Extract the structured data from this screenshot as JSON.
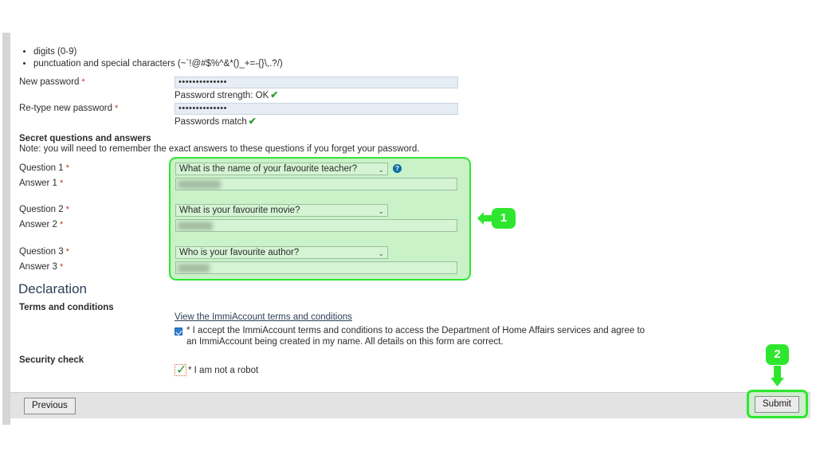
{
  "password_rules": [
    "digits (0-9)",
    "punctuation and special characters (~`!@#$%^&*()_+=-{}\\,.?/)"
  ],
  "password_section": {
    "new_password_label": "New password",
    "new_password_value": "••••••••••••••",
    "new_password_hint": "Password strength: OK",
    "retype_label": "Re-type new password",
    "retype_value": "••••••••••••••",
    "retype_hint": "Passwords match",
    "required_marker": "*",
    "tick_glyph": "✔"
  },
  "secret_section": {
    "heading": "Secret questions and answers",
    "note": "Note: you will need to remember the exact answers to these questions if you forget your password.",
    "help_icon_glyph": "?",
    "caret_glyph": "⌄",
    "rows": [
      {
        "question_label": "Question 1",
        "question_value": "What is the name of your favourite teacher?",
        "answer_label": "Answer 1",
        "answer_value": "",
        "answer_redacted": true,
        "has_help": true
      },
      {
        "question_label": "Question 2",
        "question_value": "What is your favourite movie?",
        "answer_label": "Answer 2",
        "answer_value": "",
        "answer_redacted": true,
        "has_help": false
      },
      {
        "question_label": "Question 3",
        "question_value": "Who is your favourite author?",
        "answer_label": "Answer 3",
        "answer_value": "",
        "answer_redacted": true,
        "has_help": false
      }
    ]
  },
  "declaration": {
    "heading": "Declaration",
    "terms_label": "Terms and conditions",
    "terms_link": "View the ImmiAccount terms and conditions",
    "accept_text": "* I accept the ImmiAccount terms and conditions to access the Department of Home Affairs services and agree to an ImmiAccount being created in my name. All details on this form are correct.",
    "accept_checked": true
  },
  "security": {
    "heading": "Security check",
    "robot_label": "* I am not a robot",
    "robot_checked": true,
    "robot_tick_glyph": "✓"
  },
  "footer": {
    "previous_label": "Previous",
    "submit_label": "Submit"
  },
  "annotations": {
    "step1": "1",
    "step2": "2",
    "accent_color": "#2ee62e",
    "highlight_fill": "#c9f2c9"
  },
  "colors": {
    "required_red": "#c0392b",
    "link_navy": "#2e4057",
    "input_blue": "#e6edf5",
    "tick_green": "#2e9e31",
    "checkbox_blue": "#2f7dd1",
    "robot_border": "#d4612e",
    "footer_grey": "#e3e3e3"
  }
}
